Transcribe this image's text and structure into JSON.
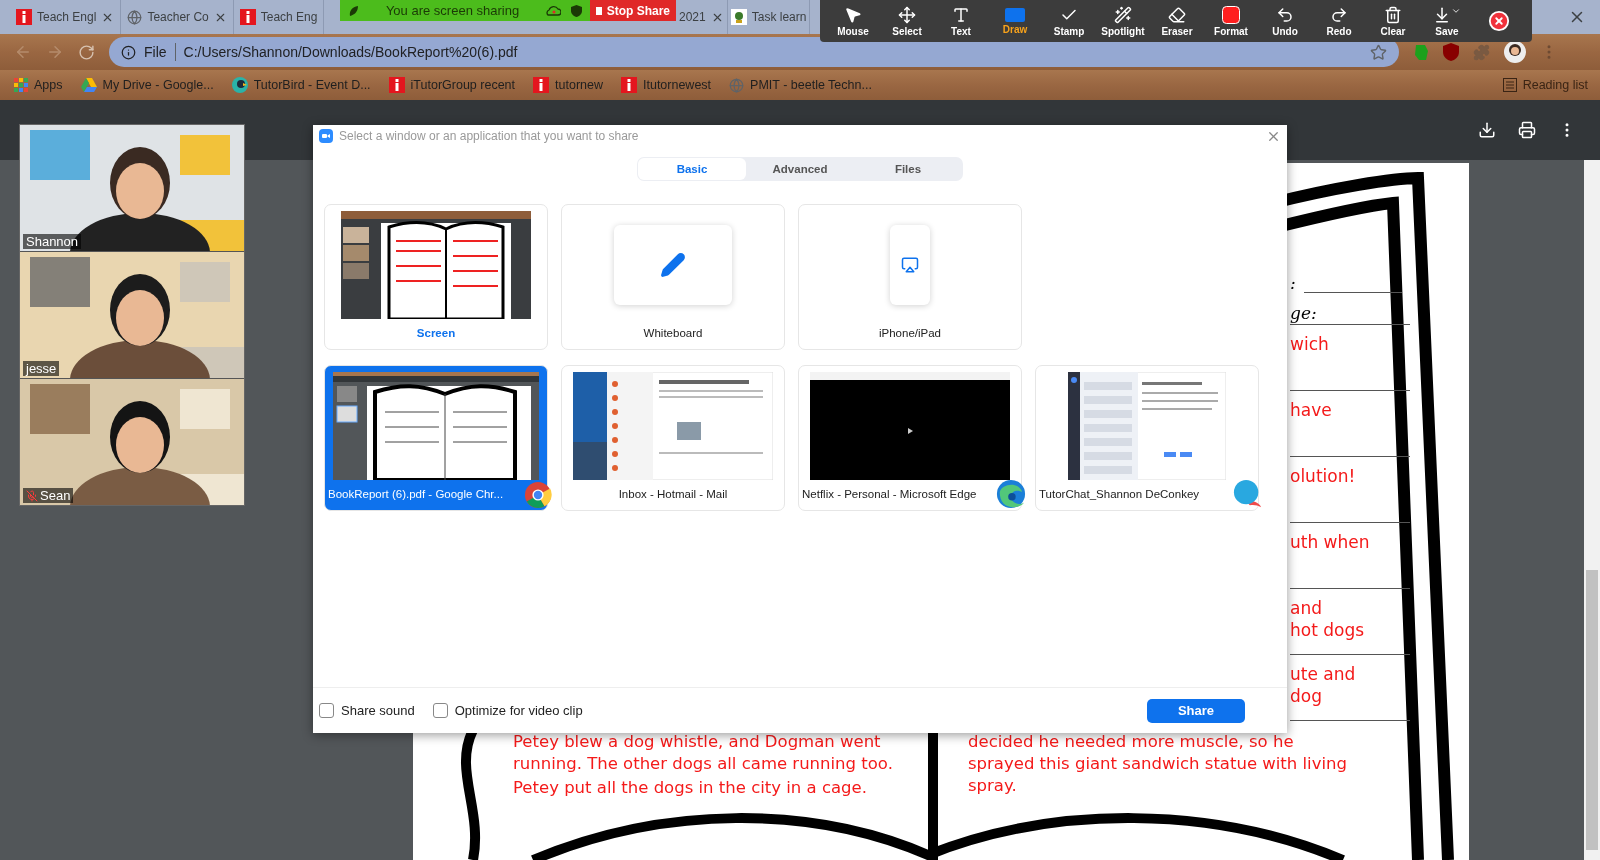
{
  "browser": {
    "tabs": [
      {
        "title": "Teach Engl"
      },
      {
        "title": "Teacher Co"
      },
      {
        "title": "Teach Eng"
      },
      {
        "title": "2021"
      },
      {
        "title": "Task learn"
      }
    ],
    "address": {
      "scheme": "File",
      "url": "C:/Users/Shannon/Downloads/BookReport%20(6).pdf"
    },
    "bookmarks": [
      {
        "label": "Apps"
      },
      {
        "label": "My Drive - Google..."
      },
      {
        "label": "TutorBird - Event D..."
      },
      {
        "label": "iTutorGroup recent"
      },
      {
        "label": "tutornew"
      },
      {
        "label": "Itutornewest"
      },
      {
        "label": "PMIT - beetle Techn..."
      }
    ],
    "reading_list": "Reading list"
  },
  "sharing_banner": {
    "status": "You are screen sharing",
    "stop_button": "Stop Share"
  },
  "annotation_toolbar": [
    {
      "label": "Mouse",
      "selected": false
    },
    {
      "label": "Select",
      "selected": false
    },
    {
      "label": "Text",
      "selected": false
    },
    {
      "label": "Draw",
      "selected": true
    },
    {
      "label": "Stamp",
      "selected": false
    },
    {
      "label": "Spotlight",
      "selected": false
    },
    {
      "label": "Eraser",
      "selected": false
    },
    {
      "label": "Format",
      "selected": false
    },
    {
      "label": "Undo",
      "selected": false
    },
    {
      "label": "Redo",
      "selected": false
    },
    {
      "label": "Clear",
      "selected": false
    },
    {
      "label": "Save",
      "selected": false
    }
  ],
  "participants": [
    {
      "name": "Shannon",
      "muted": false
    },
    {
      "name": "jesse",
      "muted": false
    },
    {
      "name": "Sean",
      "muted": true
    }
  ],
  "share_dialog": {
    "title": "Select a window or an application that you want to share",
    "tabs": [
      {
        "label": "Basic",
        "selected": true
      },
      {
        "label": "Advanced",
        "selected": false
      },
      {
        "label": "Files",
        "selected": false
      }
    ],
    "sources": [
      {
        "label": "Screen",
        "kind": "screen",
        "selected": false
      },
      {
        "label": "Whiteboard",
        "kind": "whiteboard",
        "selected": false
      },
      {
        "label": "iPhone/iPad",
        "kind": "device",
        "selected": false
      },
      {
        "label": "BookReport (6).pdf - Google Chr...",
        "kind": "document",
        "selected": true
      },
      {
        "label": "Inbox - Hotmail - Mail",
        "kind": "mail",
        "selected": false
      },
      {
        "label": "Netflix - Personal - Microsoft Edge",
        "kind": "video",
        "selected": false
      },
      {
        "label": "TutorChat_Shannon DeConkey",
        "kind": "chat",
        "selected": false
      }
    ],
    "options": [
      {
        "label": "Share sound",
        "checked": false
      },
      {
        "label": "Optimize for video clip",
        "checked": false
      }
    ],
    "share_button": "Share"
  },
  "document": {
    "fragments": [
      {
        "kind": "name",
        "lines": [
          ":"
        ]
      },
      {
        "kind": "label",
        "lines": [
          "ge:"
        ]
      },
      {
        "kind": "answer",
        "lines": [
          "wich"
        ]
      },
      {
        "kind": "answer",
        "lines": [
          "have"
        ]
      },
      {
        "kind": "answer",
        "lines": [
          "olution!"
        ]
      },
      {
        "kind": "answer",
        "lines": [
          "uth when"
        ]
      },
      {
        "kind": "answer",
        "lines": [
          "and",
          "hot dogs"
        ]
      },
      {
        "kind": "answer",
        "lines": [
          "ute and",
          "dog"
        ]
      }
    ],
    "left_column": [
      "Petey blew a dog whistle, and Dogman went running. The other dogs all came running too.",
      "Petey put all the dogs in the city in a cage."
    ],
    "right_column": [
      "decided he needed more muscle, so he sprayed  this giant sandwich statue with living spray."
    ]
  }
}
